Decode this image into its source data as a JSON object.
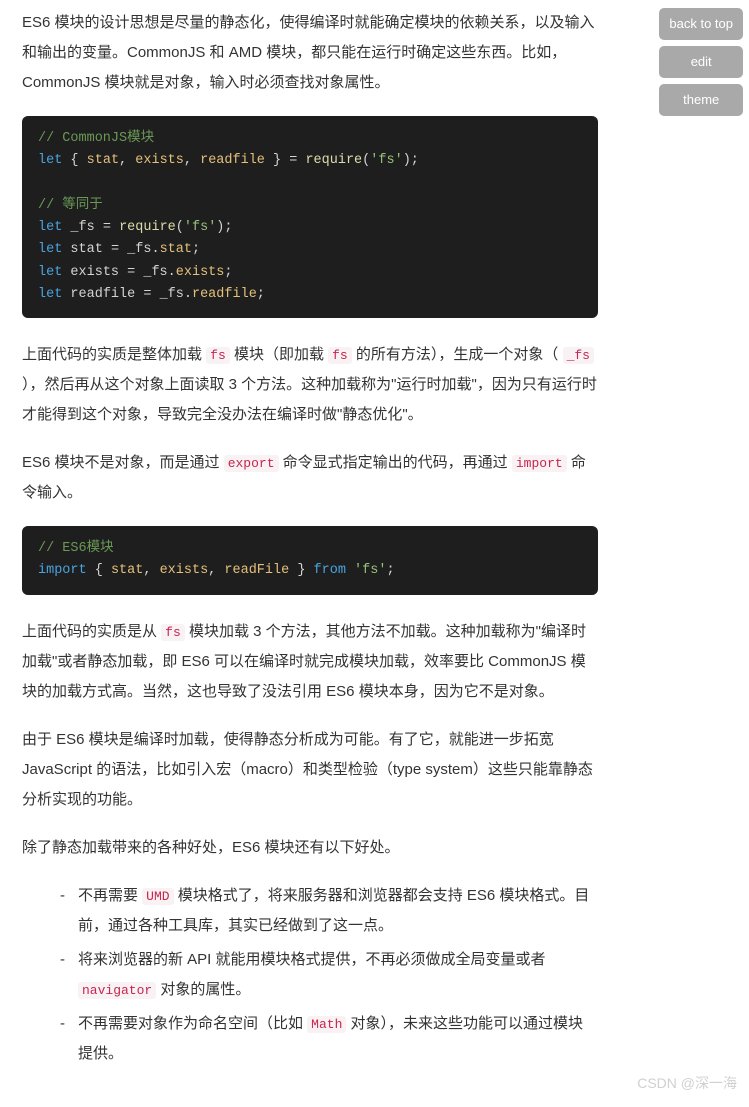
{
  "sideButtons": {
    "backToTop": "back to top",
    "edit": "edit",
    "theme": "theme"
  },
  "para1": {
    "t1": "ES6 模块的设计思想是尽量的静态化，使得编译时就能确定模块的依赖关系，以及输入和输出的变量。CommonJS 和 AMD 模块，都只能在运行时确定这些东西。比如，CommonJS 模块就是对象，输入时必须查找对象属性。"
  },
  "code1": {
    "c1": "// CommonJS模块",
    "kw_let": "let",
    "brace_o": "{",
    "p1": "stat",
    "comma": ",",
    "p2": "exists",
    "p3": "readfile",
    "brace_c": "}",
    "eq": "=",
    "fn_require": "require",
    "paren_o": "(",
    "s_fs": "'fs'",
    "paren_c": ")",
    "semi": ";",
    "c2": "// 等同于",
    "v_fs": "_fs",
    "v_stat": "stat",
    "dot": ".",
    "a_stat": "stat",
    "v_exists": "exists",
    "a_exists": "exists",
    "v_readfile": "readfile",
    "a_readfile": "readfile"
  },
  "para2": {
    "t1": "上面代码的实质是整体加载 ",
    "c1": "fs",
    "t2": " 模块（即加载 ",
    "c2": "fs",
    "t3": " 的所有方法），生成一个对象（ ",
    "c3": "_fs",
    "t4": " ），然后再从这个对象上面读取 3 个方法。这种加载称为\"运行时加载\"，因为只有运行时才能得到这个对象，导致完全没办法在编译时做\"静态优化\"。"
  },
  "para3": {
    "t1": "ES6 模块不是对象，而是通过 ",
    "c1": "export",
    "t2": " 命令显式指定输出的代码，再通过 ",
    "c2": "import",
    "t3": " 命令输入。"
  },
  "code2": {
    "c1": "// ES6模块",
    "kw_import": "import",
    "brace_o": "{",
    "p1": "stat",
    "comma": ",",
    "p2": "exists",
    "p3": "readFile",
    "brace_c": "}",
    "kw_from": "from",
    "s_fs": "'fs'",
    "semi": ";"
  },
  "para4": {
    "t1": "上面代码的实质是从 ",
    "c1": "fs",
    "t2": " 模块加载 3 个方法，其他方法不加载。这种加载称为\"编译时加载\"或者静态加载，即 ES6 可以在编译时就完成模块加载，效率要比 CommonJS 模块的加载方式高。当然，这也导致了没法引用 ES6 模块本身，因为它不是对象。"
  },
  "para5": "由于 ES6 模块是编译时加载，使得静态分析成为可能。有了它，就能进一步拓宽 JavaScript 的语法，比如引入宏（macro）和类型检验（type system）这些只能靠静态分析实现的功能。",
  "para6": "除了静态加载带来的各种好处，ES6 模块还有以下好处。",
  "list": {
    "i1": {
      "t1": "不再需要 ",
      "c1": "UMD",
      "t2": " 模块格式了，将来服务器和浏览器都会支持 ES6 模块格式。目前，通过各种工具库，其实已经做到了这一点。"
    },
    "i2": {
      "t1": "将来浏览器的新 API 就能用模块格式提供，不再必须做成全局变量或者 ",
      "c1": "navigator",
      "t2": " 对象的属性。"
    },
    "i3": {
      "t1": "不再需要对象作为命名空间（比如 ",
      "c1": "Math",
      "t2": " 对象），未来这些功能可以通过模块提供。"
    }
  },
  "watermark": "CSDN @深一海"
}
